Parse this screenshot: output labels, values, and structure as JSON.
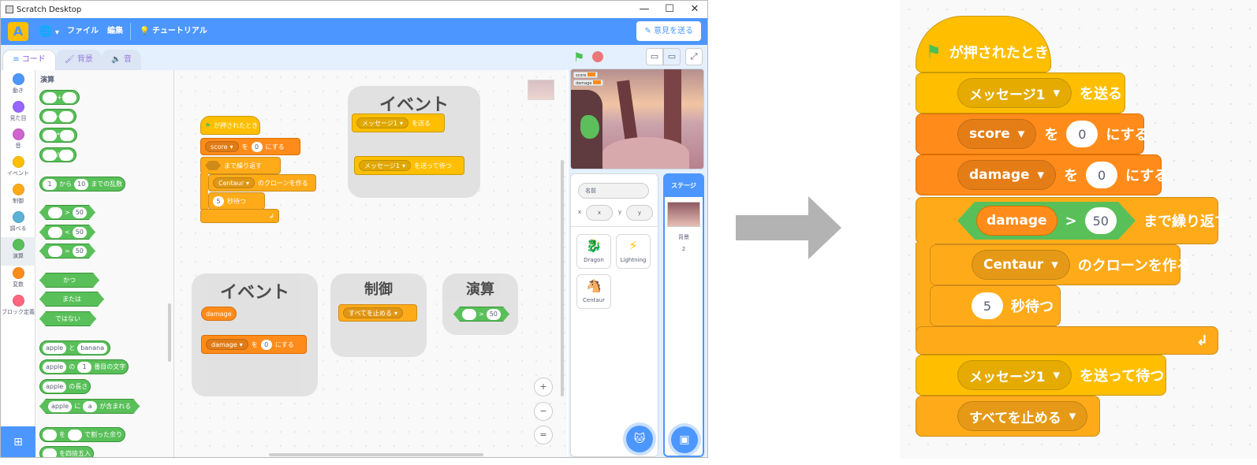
{
  "window": {
    "title": "Scratch Desktop",
    "controls": [
      "—",
      "☐",
      "✕"
    ]
  },
  "menubar": {
    "file": "ファイル",
    "edit": "編集",
    "tutorial": "チュートリアル",
    "feedback": "意見を送る"
  },
  "tabs": {
    "code": "コード",
    "costume": "背景",
    "sound": "音"
  },
  "categories": [
    {
      "label": "動き",
      "color": "#4c97ff"
    },
    {
      "label": "見た目",
      "color": "#9966ff"
    },
    {
      "label": "音",
      "color": "#cf63cf"
    },
    {
      "label": "イベント",
      "color": "#ffbf00"
    },
    {
      "label": "制御",
      "color": "#ffab19"
    },
    {
      "label": "調べる",
      "color": "#5cb1d6"
    },
    {
      "label": "演算",
      "color": "#59c059"
    },
    {
      "label": "変数",
      "color": "#ff8c1a"
    },
    {
      "label": "ブロック定義",
      "color": "#ff6680"
    }
  ],
  "palette": {
    "heading": "演算",
    "arith": [
      "+",
      "-",
      "*",
      "/"
    ],
    "random": {
      "from": "1",
      "from_label": "から",
      "to": "10",
      "to_label": "までの乱数"
    },
    "compare": [
      {
        "op": ">",
        "v": "50"
      },
      {
        "op": "<",
        "v": "50"
      },
      {
        "op": "=",
        "v": "50"
      }
    ],
    "logic": [
      "かつ",
      "または",
      "ではない"
    ],
    "join": {
      "a": "apple",
      "label": "と",
      "b": "banana"
    },
    "letter": {
      "a": "apple",
      "label1": "の",
      "n": "1",
      "label2": "番目の文字"
    },
    "length": {
      "a": "apple",
      "label": "の長さ"
    },
    "contains": {
      "a": "apple",
      "label1": "に",
      "b": "a",
      "label2": "が含まれる"
    },
    "mod": {
      "label1": "を",
      "label2": "で割った余り"
    },
    "round": "を四捨五入"
  },
  "workspace": {
    "hat": "が押されたとき",
    "set_score": {
      "var": "score",
      "label1": "を",
      "val": "0",
      "label2": "にする"
    },
    "repeat_until": "まで繰り返す",
    "clone": {
      "target": "Centaur",
      "label": "のクローンを作る"
    },
    "wait": {
      "val": "5",
      "label": "秒待つ"
    },
    "comments": [
      "イベント",
      "イベント",
      "制御",
      "演算"
    ],
    "broadcast": {
      "msg": "メッセージ1",
      "label": "を送る"
    },
    "broadcast_wait": {
      "msg": "メッセージ1",
      "label": "を送って待つ"
    },
    "damage_reporter": "damage",
    "set_damage": {
      "var": "damage",
      "label1": "を",
      "val": "0",
      "label2": "にする"
    },
    "stop_all": "すべてを止める",
    "gt": {
      "op": ">",
      "v": "50"
    },
    "zoom_buttons": [
      "+",
      "−",
      "="
    ]
  },
  "stage": {
    "monitors": [
      "score",
      "damage"
    ]
  },
  "sprite_info": {
    "name_placeholder": "名前",
    "x_label": "x",
    "x_val": "x",
    "y_label": "y",
    "y_val": "y"
  },
  "sprites": [
    "Dragon",
    "Lightning",
    "Centaur"
  ],
  "stage_pane": {
    "title": "ステージ",
    "backdrops_label": "背景",
    "backdrops_count": "2"
  },
  "zoom": {
    "hat": "が押されたとき",
    "broadcast": {
      "msg": "メッセージ1",
      "label": "を送る"
    },
    "set_score": {
      "var": "score",
      "label1": "を",
      "val": "0",
      "label2": "にする"
    },
    "set_damage": {
      "var": "damage",
      "label1": "を",
      "val": "0",
      "label2": "にする"
    },
    "repeat_until": {
      "var": "damage",
      "op": ">",
      "val": "50",
      "label": "まで繰り返す"
    },
    "clone": {
      "target": "Centaur",
      "label": "のクローンを作る"
    },
    "wait": {
      "val": "5",
      "label": "秒待つ"
    },
    "broadcast_wait": {
      "msg": "メッセージ1",
      "label": "を送って待つ"
    },
    "stop_all": "すべてを止める"
  }
}
